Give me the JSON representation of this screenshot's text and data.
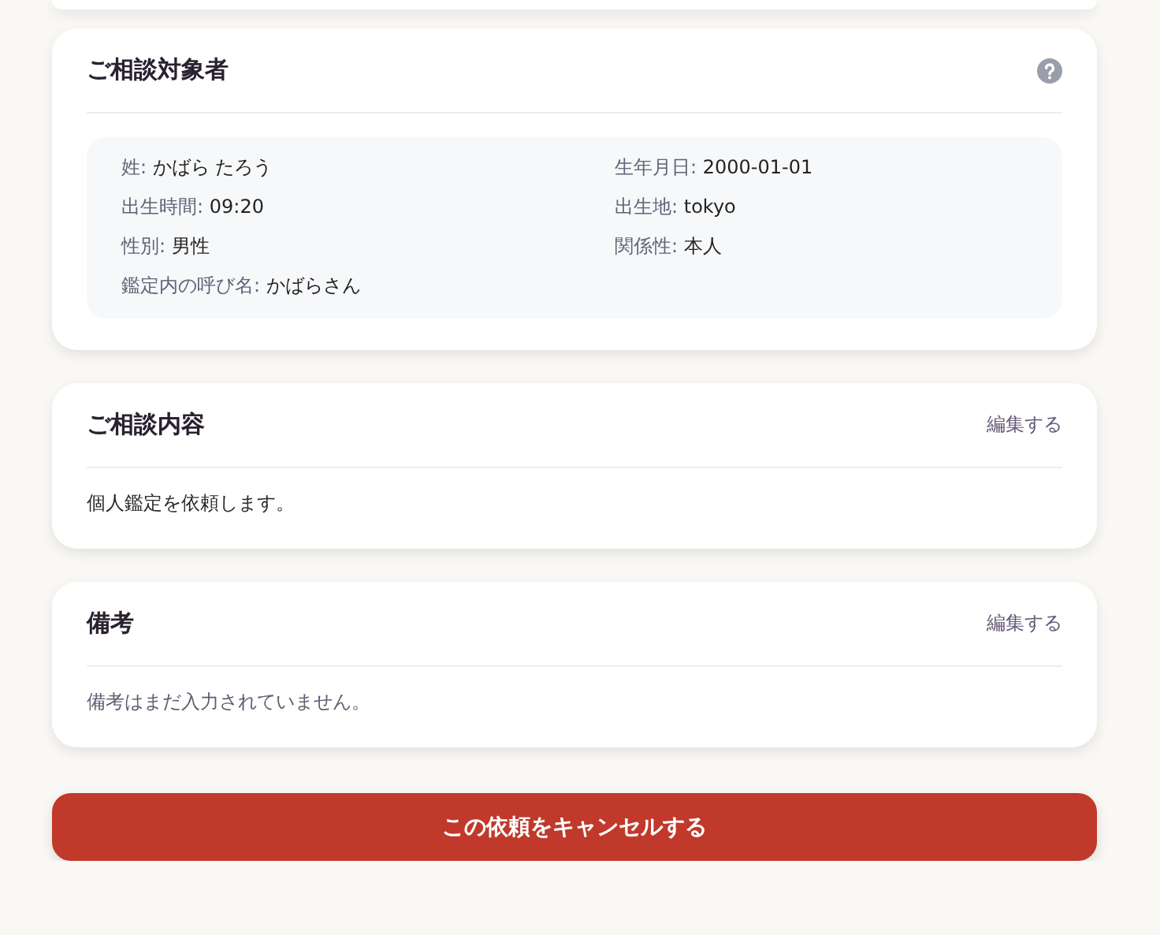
{
  "subject": {
    "title": "ご相談対象者",
    "fields": [
      {
        "label": "姓:",
        "value": "かばら たろう"
      },
      {
        "label": "生年月日:",
        "value": "2000-01-01"
      },
      {
        "label": "出生時間:",
        "value": "09:20"
      },
      {
        "label": "出生地:",
        "value": "tokyo"
      },
      {
        "label": "性別:",
        "value": "男性"
      },
      {
        "label": "関係性:",
        "value": "本人"
      },
      {
        "label": "鑑定内の呼び名:",
        "value": "かばらさん"
      }
    ]
  },
  "sections": [
    {
      "title": "ご相談内容",
      "edit_link": "編集する",
      "body": "個人鑑定を依頼します。",
      "empty": false
    },
    {
      "title": "備考",
      "edit_link": "編集する",
      "body": "備考はまだ入力されていません。",
      "empty": true
    }
  ],
  "cancel_button": "この依頼をキャンセルする"
}
